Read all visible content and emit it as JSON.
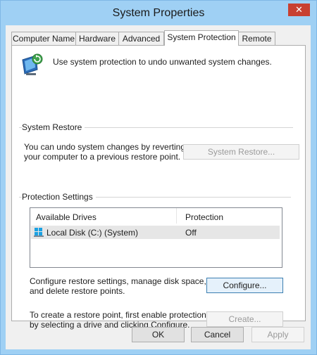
{
  "window": {
    "title": "System Properties",
    "close_glyph": "✕"
  },
  "tabs": [
    {
      "label": "Computer Name",
      "active": false
    },
    {
      "label": "Hardware",
      "active": false
    },
    {
      "label": "Advanced",
      "active": false
    },
    {
      "label": "System Protection",
      "active": true
    },
    {
      "label": "Remote",
      "active": false
    }
  ],
  "intro": {
    "icon": "system-protection-icon",
    "text": "Use system protection to undo unwanted system changes."
  },
  "system_restore": {
    "heading": "System Restore",
    "description_line1": "You can undo system changes by reverting",
    "description_line2": "your computer to a previous restore point.",
    "button_label": "System Restore..."
  },
  "protection_settings": {
    "heading": "Protection Settings",
    "columns": [
      "Available Drives",
      "Protection"
    ],
    "drives": [
      {
        "icon": "local-disk-icon",
        "name": "Local Disk (C:) (System)",
        "protection": "Off"
      }
    ],
    "configure_text_line1": "Configure restore settings, manage disk space,",
    "configure_text_line2": "and delete restore points.",
    "configure_button": "Configure...",
    "create_text_line1": "To create a restore point, first enable protection",
    "create_text_line2": "by selecting a drive and clicking Configure.",
    "create_button": "Create..."
  },
  "footer": {
    "ok": "OK",
    "cancel": "Cancel",
    "apply": "Apply"
  },
  "colors": {
    "title_bar": "#9fd0f4",
    "close_button": "#c84031",
    "dialog_bg": "#f0f0f0",
    "selected_row": "#e6e6e6"
  }
}
